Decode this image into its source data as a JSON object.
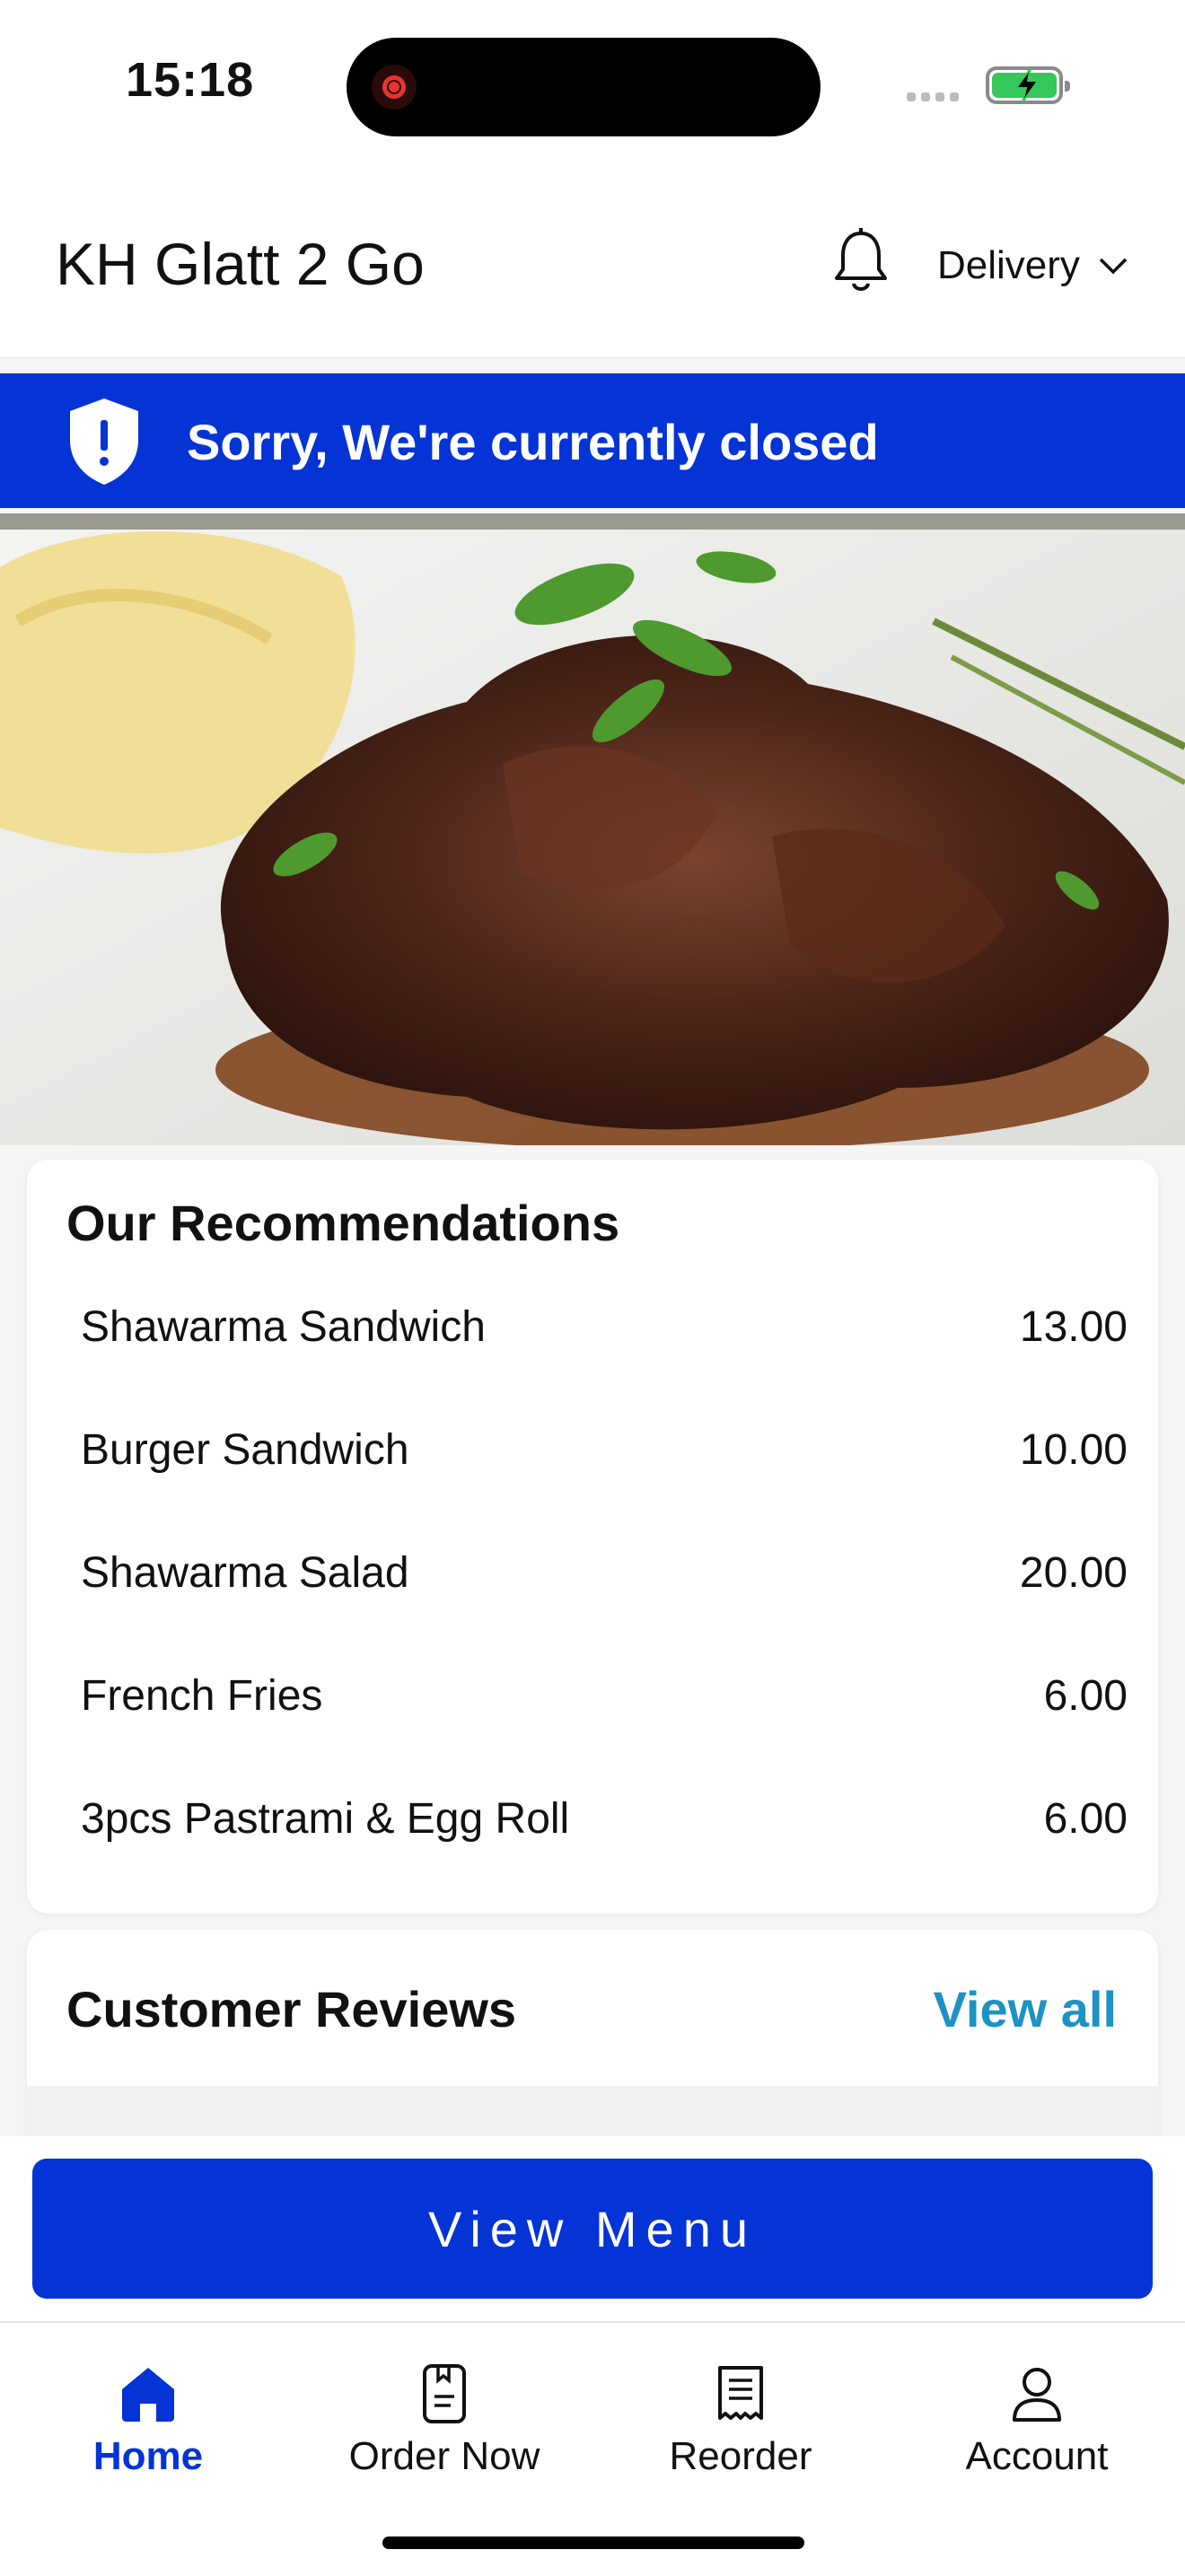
{
  "status_bar": {
    "time": "15:18"
  },
  "header": {
    "title": "KH Glatt 2 Go",
    "bell_icon": "bell-icon",
    "delivery_mode": "Delivery"
  },
  "banner": {
    "text": "Sorry, We're currently closed",
    "icon": "shield-exclamation-icon",
    "color": "#0433d6"
  },
  "hero": {
    "description": "hero-food-photo"
  },
  "recommendations": {
    "title": "Our Recommendations",
    "items": [
      {
        "name": "Shawarma Sandwich",
        "price": "13.00"
      },
      {
        "name": "Burger Sandwich",
        "price": "10.00"
      },
      {
        "name": "Shawarma Salad",
        "price": "20.00"
      },
      {
        "name": "French Fries",
        "price": "6.00"
      },
      {
        "name": "3pcs Pastrami & Egg Roll",
        "price": "6.00"
      }
    ]
  },
  "reviews": {
    "title": "Customer Reviews",
    "view_all": "View all",
    "link_color": "#1d92c3"
  },
  "cta": {
    "label": "View Menu",
    "color": "#0433d6"
  },
  "tabs": [
    {
      "label": "Home",
      "icon": "home-icon",
      "active": true
    },
    {
      "label": "Order Now",
      "icon": "order-icon",
      "active": false
    },
    {
      "label": "Reorder",
      "icon": "receipt-icon",
      "active": false
    },
    {
      "label": "Account",
      "icon": "account-icon",
      "active": false
    }
  ]
}
